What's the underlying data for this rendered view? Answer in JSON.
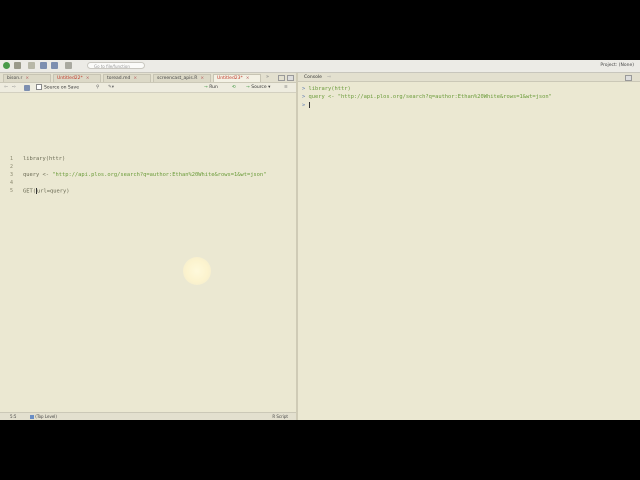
{
  "toolbar": {
    "goto_placeholder": "Go to file/function",
    "project_label": "Project: (None)"
  },
  "editor": {
    "tabs": [
      {
        "label": "bison.r",
        "close": "×",
        "active": false,
        "unsaved": false
      },
      {
        "label": "Untitled22*",
        "close": "×",
        "active": false,
        "unsaved": true
      },
      {
        "label": "toread.md",
        "close": "×",
        "active": false,
        "unsaved": false
      },
      {
        "label": "screencast_apis.R",
        "close": "×",
        "active": false,
        "unsaved": false
      },
      {
        "label": "Untitled23*",
        "close": "×",
        "active": true,
        "unsaved": true
      }
    ],
    "source_on_save": "Source on Save",
    "run_label": "Run",
    "source_label": "Source",
    "lines": [
      {
        "num": "1",
        "code": "library(httr)"
      },
      {
        "num": "2",
        "code": ""
      },
      {
        "num": "3",
        "code_prefix": "query <- ",
        "code_string": "\"http://api.plos.org/search?q=author:Ethan%20White&rows=1&wt=json\""
      },
      {
        "num": "4",
        "code": ""
      },
      {
        "num": "5",
        "code_prefix": "GET(",
        "code_suffix": "url=query)"
      }
    ],
    "status": {
      "position": "5:5",
      "scope": "(Top Level)",
      "file_type": "R Script"
    }
  },
  "console": {
    "title": "Console",
    "lines": [
      {
        "prompt": ">",
        "code": "library(httr)"
      },
      {
        "prompt": ">",
        "code": "query <- \"http://api.plos.org/search?q=author:Ethan%20White&rows=1&wt=json\""
      },
      {
        "prompt": ">",
        "code": ""
      }
    ]
  },
  "colors": {
    "background": "#e9e5d0",
    "keyword": "#5d7ab2",
    "string": "#6a9b39",
    "unsaved_tab": "#c0392b"
  }
}
